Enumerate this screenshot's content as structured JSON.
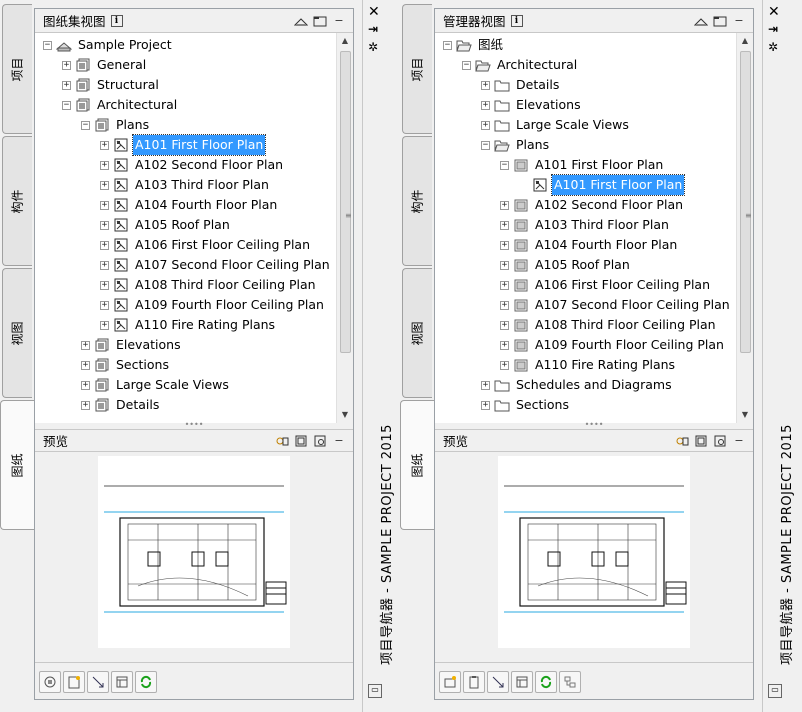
{
  "colors": {
    "selection": "#3399ff",
    "refresh_icon": "#1aa11a"
  },
  "left": {
    "tabs": [
      "项目",
      "构件",
      "视图",
      "图纸"
    ],
    "active_tab": "图纸",
    "header_title": "图纸集视图",
    "preview_title": "预览",
    "side_title": "项目导航器 - SAMPLE PROJECT 2015",
    "tree": [
      {
        "label": "Sample Project",
        "depth": 0,
        "exp": "−",
        "icon": "project-icon"
      },
      {
        "label": "General",
        "depth": 1,
        "exp": "+",
        "icon": "sheet-set-icon"
      },
      {
        "label": "Structural",
        "depth": 1,
        "exp": "+",
        "icon": "sheet-set-icon"
      },
      {
        "label": "Architectural",
        "depth": 1,
        "exp": "−",
        "icon": "sheet-set-icon"
      },
      {
        "label": "Plans",
        "depth": 2,
        "exp": "−",
        "icon": "sheet-set-icon"
      },
      {
        "label": "A101 First Floor Plan",
        "depth": 3,
        "exp": "+",
        "icon": "sheet-icon",
        "selected": true
      },
      {
        "label": "A102 Second Floor Plan",
        "depth": 3,
        "exp": "+",
        "icon": "sheet-icon"
      },
      {
        "label": "A103 Third Floor Plan",
        "depth": 3,
        "exp": "+",
        "icon": "sheet-icon"
      },
      {
        "label": "A104 Fourth Floor Plan",
        "depth": 3,
        "exp": "+",
        "icon": "sheet-icon"
      },
      {
        "label": "A105 Roof Plan",
        "depth": 3,
        "exp": "+",
        "icon": "sheet-icon"
      },
      {
        "label": "A106 First Floor Ceiling Plan",
        "depth": 3,
        "exp": "+",
        "icon": "sheet-icon"
      },
      {
        "label": "A107 Second Floor Ceiling Plan",
        "depth": 3,
        "exp": "+",
        "icon": "sheet-icon"
      },
      {
        "label": "A108 Third Floor Ceiling Plan",
        "depth": 3,
        "exp": "+",
        "icon": "sheet-icon"
      },
      {
        "label": "A109 Fourth Floor Ceiling Plan",
        "depth": 3,
        "exp": "+",
        "icon": "sheet-icon"
      },
      {
        "label": "A110 Fire Rating Plans",
        "depth": 3,
        "exp": "+",
        "icon": "sheet-icon"
      },
      {
        "label": "Elevations",
        "depth": 2,
        "exp": "+",
        "icon": "sheet-set-icon"
      },
      {
        "label": "Sections",
        "depth": 2,
        "exp": "+",
        "icon": "sheet-set-icon"
      },
      {
        "label": "Large Scale Views",
        "depth": 2,
        "exp": "+",
        "icon": "sheet-set-icon"
      },
      {
        "label": "Details",
        "depth": 2,
        "exp": "+",
        "icon": "sheet-set-icon"
      }
    ]
  },
  "right": {
    "tabs": [
      "项目",
      "构件",
      "视图",
      "图纸"
    ],
    "active_tab": "图纸",
    "header_title": "管理器视图",
    "preview_title": "预览",
    "side_title": "项目导航器 - SAMPLE PROJECT 2015",
    "tree": [
      {
        "label": "图纸",
        "depth": 0,
        "exp": "−",
        "icon": "open-folder-icon"
      },
      {
        "label": "Architectural",
        "depth": 1,
        "exp": "−",
        "icon": "open-folder-icon"
      },
      {
        "label": "Details",
        "depth": 2,
        "exp": "+",
        "icon": "folder-icon"
      },
      {
        "label": "Elevations",
        "depth": 2,
        "exp": "+",
        "icon": "folder-icon"
      },
      {
        "label": "Large Scale Views",
        "depth": 2,
        "exp": "+",
        "icon": "folder-icon"
      },
      {
        "label": "Plans",
        "depth": 2,
        "exp": "−",
        "icon": "open-folder-icon"
      },
      {
        "label": "A101 First Floor Plan",
        "depth": 3,
        "exp": "−",
        "icon": "sheet-file-icon"
      },
      {
        "label": "A101 First Floor Plan",
        "depth": 4,
        "exp": "",
        "icon": "sheet-icon",
        "selected": true
      },
      {
        "label": "A102 Second Floor Plan",
        "depth": 3,
        "exp": "+",
        "icon": "sheet-file-icon"
      },
      {
        "label": "A103 Third Floor Plan",
        "depth": 3,
        "exp": "+",
        "icon": "sheet-file-icon"
      },
      {
        "label": "A104 Fourth Floor Plan",
        "depth": 3,
        "exp": "+",
        "icon": "sheet-file-icon"
      },
      {
        "label": "A105 Roof Plan",
        "depth": 3,
        "exp": "+",
        "icon": "sheet-file-icon"
      },
      {
        "label": "A106 First Floor Ceiling Plan",
        "depth": 3,
        "exp": "+",
        "icon": "sheet-file-icon"
      },
      {
        "label": "A107 Second Floor Ceiling Plan",
        "depth": 3,
        "exp": "+",
        "icon": "sheet-file-icon"
      },
      {
        "label": "A108 Third Floor Ceiling Plan",
        "depth": 3,
        "exp": "+",
        "icon": "sheet-file-icon"
      },
      {
        "label": "A109 Fourth Floor Ceiling Plan",
        "depth": 3,
        "exp": "+",
        "icon": "sheet-file-icon"
      },
      {
        "label": "A110 Fire Rating Plans",
        "depth": 3,
        "exp": "+",
        "icon": "sheet-file-icon"
      },
      {
        "label": "Schedules and Diagrams",
        "depth": 2,
        "exp": "+",
        "icon": "folder-icon"
      },
      {
        "label": "Sections",
        "depth": 2,
        "exp": "+",
        "icon": "folder-icon"
      }
    ]
  }
}
